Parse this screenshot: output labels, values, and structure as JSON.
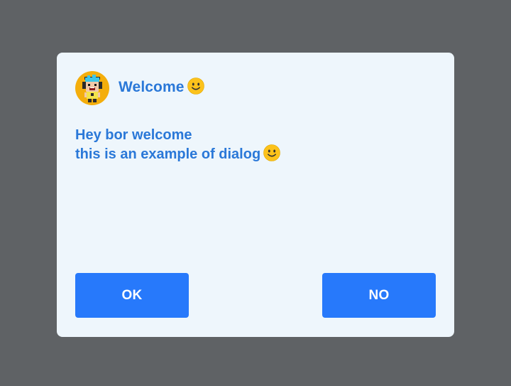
{
  "dialog": {
    "title": "Welcome",
    "title_emoji": "slightly-smiling-face-icon",
    "avatar_icon": "pixel-character-avatar-icon",
    "message_line1": "Hey bor welcome",
    "message_line2": "this is an example of dialog",
    "message_emoji": "slightly-smiling-face-icon",
    "ok_label": "OK",
    "no_label": "NO"
  },
  "colors": {
    "backdrop": "#5f6265",
    "dialog_bg": "#eef6fc",
    "text_accent": "#2a78d8",
    "button_bg": "#2779fb",
    "button_text": "#ffffff",
    "avatar_bg": "#f4ae0c"
  }
}
